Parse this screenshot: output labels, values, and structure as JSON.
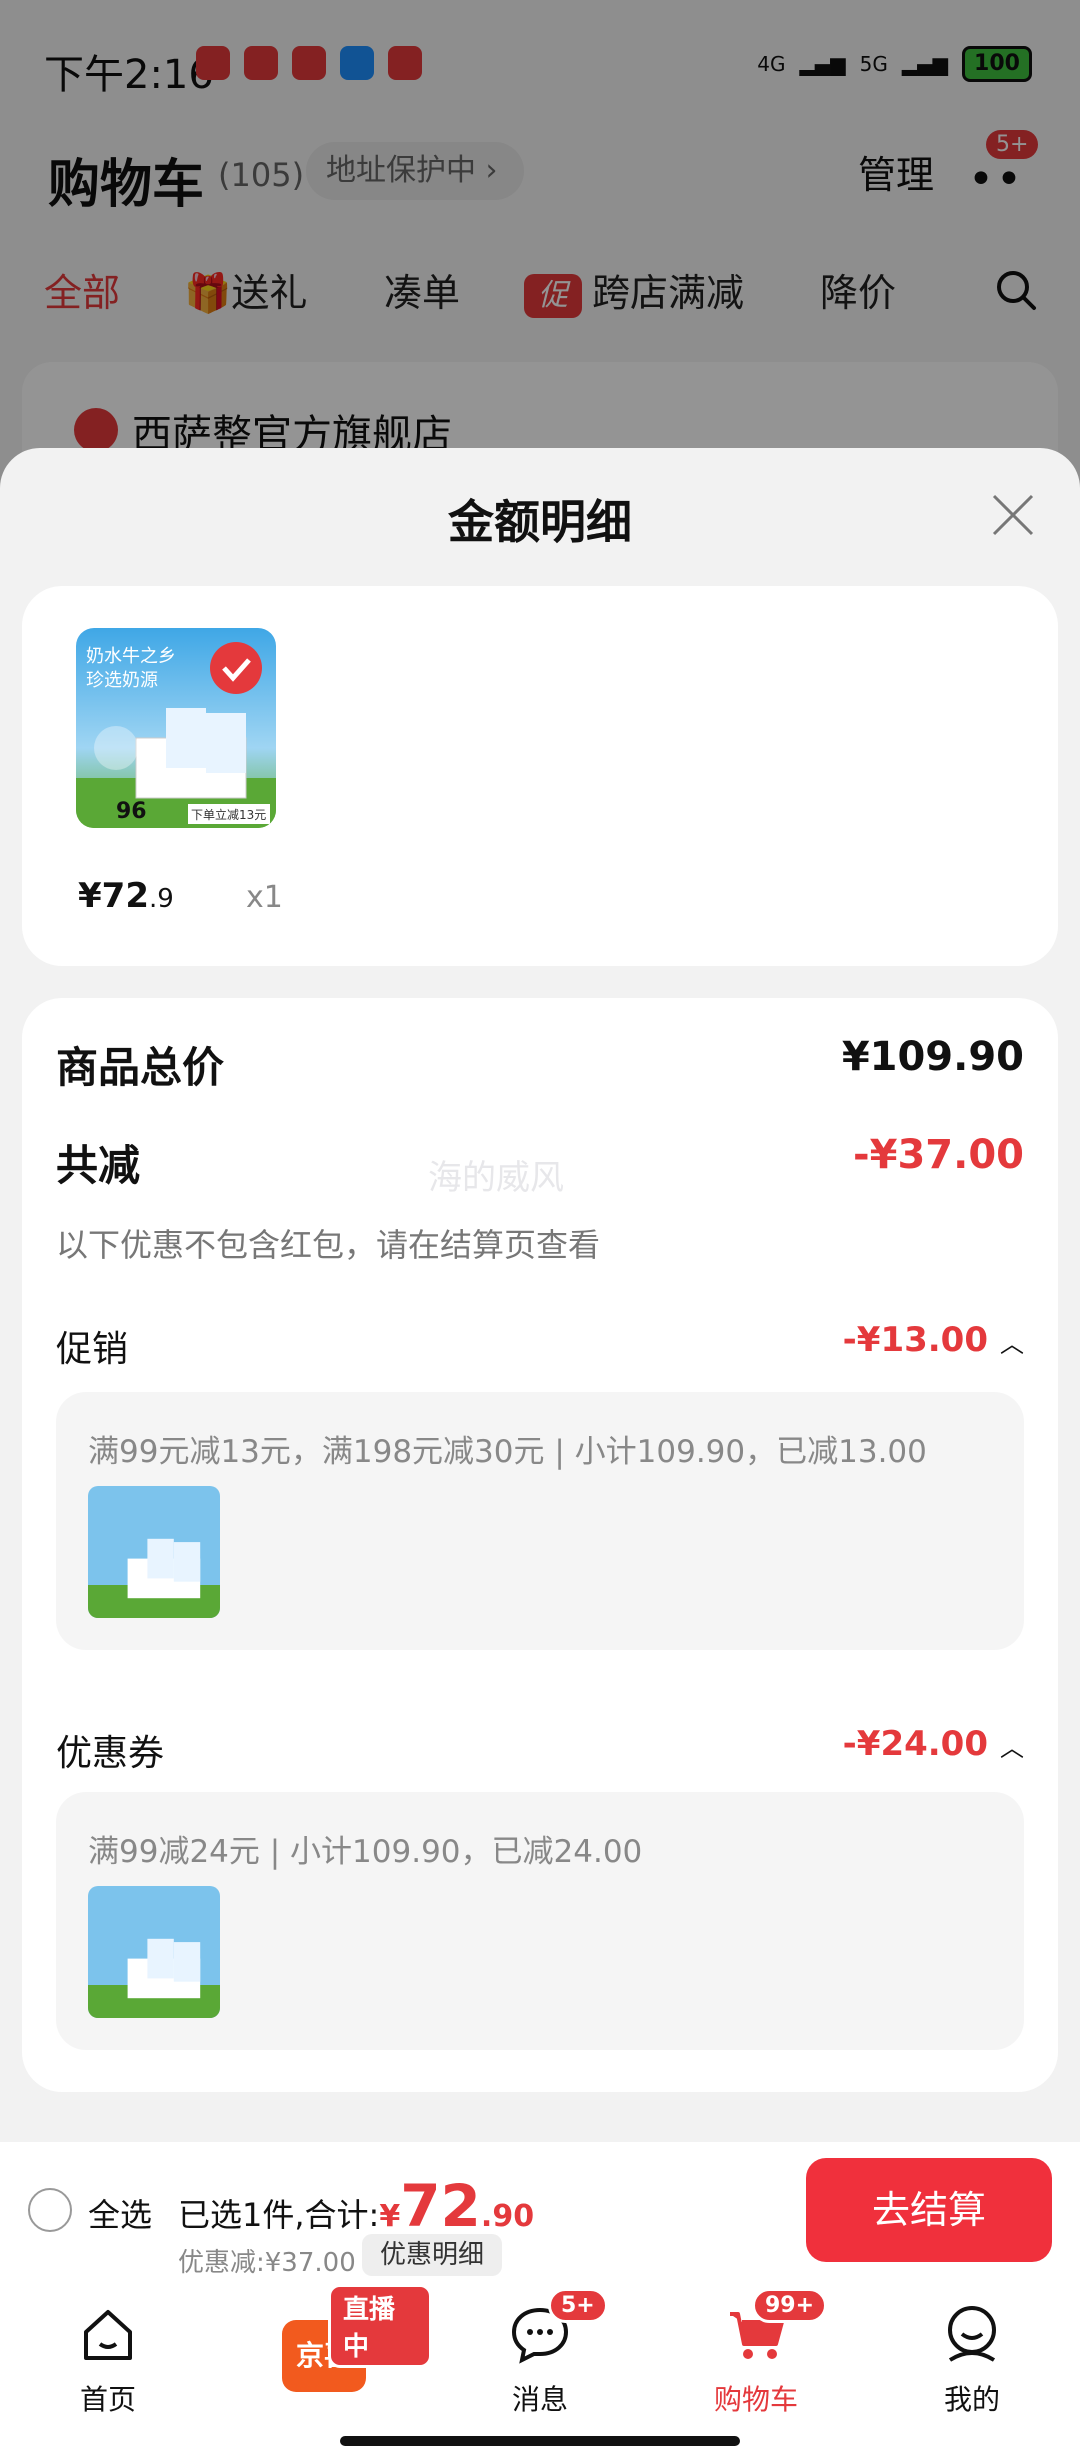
{
  "status_bar": {
    "time": "下午2:16",
    "network1": "4G",
    "network2": "5G",
    "battery": "100"
  },
  "header": {
    "title": "购物车",
    "count": "(105)",
    "address_pill": "地址保护中",
    "manage": "管理",
    "more_badge": "5+"
  },
  "tabs": [
    {
      "label": "全部"
    },
    {
      "label": "送礼"
    },
    {
      "label": "凑单"
    },
    {
      "label": "跨店满减",
      "tag": "促"
    },
    {
      "label": "降价"
    }
  ],
  "store": {
    "name": "西萨整官方旗舰店"
  },
  "sheet": {
    "title": "金额明细",
    "product": {
      "price_main": "¥72",
      "price_dec": ".9",
      "qty": "x1",
      "img_text1": "奶水牛之乡",
      "img_text2": "珍选奶源",
      "img_price": "96",
      "img_promo": "下单立减13元"
    },
    "total_label": "商品总价",
    "total_value": "¥109.90",
    "reduce_label": "共减",
    "reduce_value": "-¥37.00",
    "note": "以下优惠不包含红包，请在结算页查看",
    "watermark": "海的威风",
    "promo": {
      "label": "促销",
      "value": "-¥13.00",
      "text": "满99元减13元，满198元减30元 | 小计109.90，已减13.00"
    },
    "coupon": {
      "label": "优惠券",
      "value": "-¥24.00",
      "text": "满99减24元 | 小计109.90，已减24.00"
    }
  },
  "checkout": {
    "select_all": "全选",
    "summary_prefix": "已选1件,合计:",
    "price_symbol": "¥",
    "price_int": "72",
    "price_dec": ".90",
    "discount": "优惠减:¥37.00",
    "detail_button": "优惠明细",
    "submit": "去结算"
  },
  "navbar": [
    {
      "label": "首页",
      "icon": "home-icon"
    },
    {
      "label": "京喜",
      "badge": "直播中",
      "icon": "jingxi-icon"
    },
    {
      "label": "消息",
      "badge": "5+",
      "icon": "message-icon"
    },
    {
      "label": "购物车",
      "badge": "99+",
      "icon": "cart-icon"
    },
    {
      "label": "我的",
      "icon": "profile-icon"
    }
  ],
  "colors": {
    "accent": "#e4393c",
    "checkout": "#f0303c"
  }
}
